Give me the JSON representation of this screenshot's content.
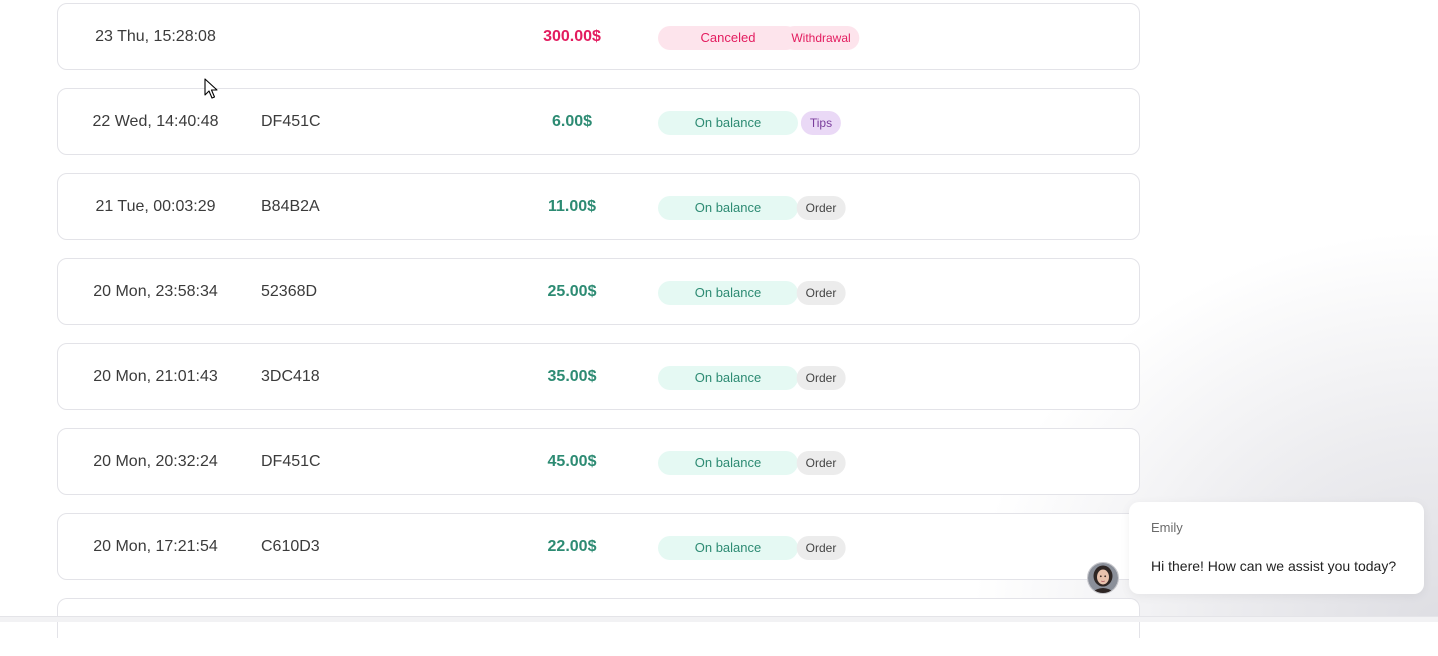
{
  "transactions": [
    {
      "date": "23 Thu, 15:28:08",
      "ref": "",
      "amount": "300.00$",
      "amount_kind": "negative",
      "status": "Canceled",
      "status_kind": "canceled",
      "type": "Withdrawal",
      "type_kind": "withdrawal"
    },
    {
      "date": "22 Wed, 14:40:48",
      "ref": "DF451C",
      "amount": "6.00$",
      "amount_kind": "positive",
      "status": "On balance",
      "status_kind": "onbalance",
      "type": "Tips",
      "type_kind": "tips"
    },
    {
      "date": "21 Tue, 00:03:29",
      "ref": "B84B2A",
      "amount": "11.00$",
      "amount_kind": "positive",
      "status": "On balance",
      "status_kind": "onbalance",
      "type": "Order",
      "type_kind": "order"
    },
    {
      "date": "20 Mon, 23:58:34",
      "ref": "52368D",
      "amount": "25.00$",
      "amount_kind": "positive",
      "status": "On balance",
      "status_kind": "onbalance",
      "type": "Order",
      "type_kind": "order"
    },
    {
      "date": "20 Mon, 21:01:43",
      "ref": "3DC418",
      "amount": "35.00$",
      "amount_kind": "positive",
      "status": "On balance",
      "status_kind": "onbalance",
      "type": "Order",
      "type_kind": "order"
    },
    {
      "date": "20 Mon, 20:32:24",
      "ref": "DF451C",
      "amount": "45.00$",
      "amount_kind": "positive",
      "status": "On balance",
      "status_kind": "onbalance",
      "type": "Order",
      "type_kind": "order"
    },
    {
      "date": "20 Mon, 17:21:54",
      "ref": "C610D3",
      "amount": "22.00$",
      "amount_kind": "positive",
      "status": "On balance",
      "status_kind": "onbalance",
      "type": "Order",
      "type_kind": "order"
    }
  ],
  "chat": {
    "agent_name": "Emily",
    "message": "Hi there! How can we assist you today?",
    "avatar_icon": "agent-avatar"
  },
  "colors": {
    "negative": "#e31c5f",
    "positive": "#2d8b73",
    "canceled_bg": "#fde4ec",
    "onbalance_bg": "#e5f9f3",
    "tips_bg": "#ead9f6",
    "order_bg": "#ececec"
  },
  "icons": {
    "cursor": "mouse-pointer-icon"
  }
}
